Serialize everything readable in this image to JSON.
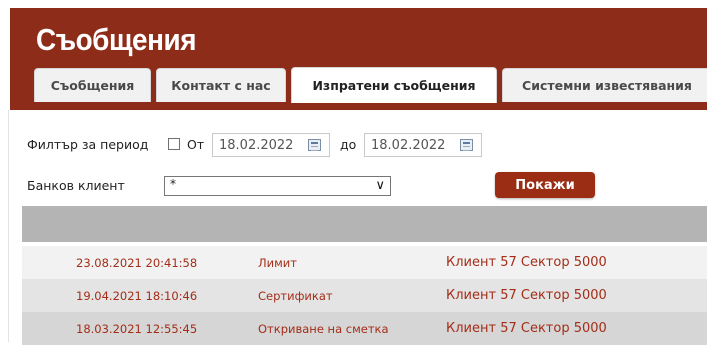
{
  "header": {
    "title": "Съобщения",
    "bg_color": "#8e2c1a"
  },
  "tabs": [
    {
      "label": "Съобщения",
      "active": false
    },
    {
      "label": "Контакт с нас",
      "active": false
    },
    {
      "label": "Изпратени съобщения",
      "active": true
    },
    {
      "label": "Системни известявания",
      "active": false
    }
  ],
  "filter": {
    "period_label": "Филтър за период",
    "from_label": "От",
    "from_value": "18.02.2022",
    "to_label": "до",
    "to_value": "18.02.2022",
    "period_checked": false
  },
  "client": {
    "label": "Банков клиент",
    "selected": "*"
  },
  "show_button": "Покажи",
  "rows": [
    {
      "datetime": "23.08.2021 20:41:58",
      "subject": "Лимит",
      "client": "Клиент 57 Сектор 5000"
    },
    {
      "datetime": "19.04.2021 18:10:46",
      "subject": "Сертификат",
      "client": "Клиент 57 Сектор 5000"
    },
    {
      "datetime": "18.03.2021 12:55:45",
      "subject": "Откриване на сметка",
      "client": "Клиент 57 Сектор 5000"
    }
  ],
  "colors": {
    "accent": "#9b2d14",
    "row_text": "#a32d18",
    "grid_header": "#b4b4b4",
    "row_alt": "#e4e4e4",
    "row_even": "#f2f2f2"
  }
}
